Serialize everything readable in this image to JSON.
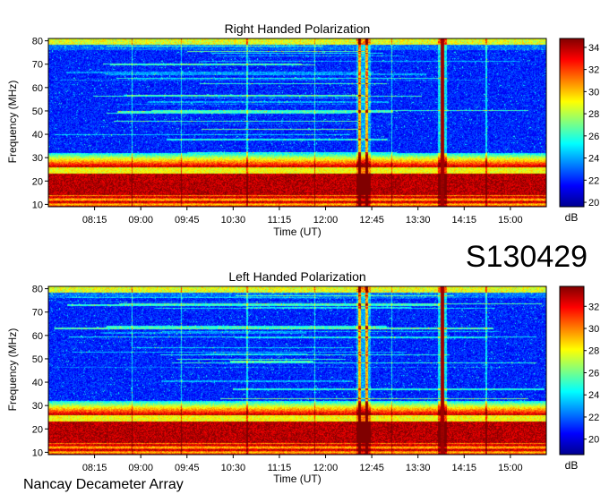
{
  "chart_data": [
    {
      "type": "heatmap",
      "title": "Right Handed Polarization",
      "xlabel": "Time (UT)",
      "ylabel": "Frequency (MHz)",
      "x_ticks": [
        "08:15",
        "09:00",
        "09:45",
        "10:30",
        "11:15",
        "12:00",
        "12:45",
        "13:30",
        "14:15",
        "15:00"
      ],
      "x_tick_minutes": [
        495,
        540,
        585,
        630,
        675,
        720,
        765,
        810,
        855,
        900
      ],
      "xlim_minutes": [
        450,
        935
      ],
      "y_ticks": [
        10,
        20,
        30,
        40,
        50,
        60,
        70,
        80
      ],
      "ylim": [
        9,
        81
      ],
      "colorbar": {
        "label": "dB",
        "ticks": [
          20,
          22,
          24,
          26,
          28,
          30,
          32,
          34
        ],
        "range": [
          19.6,
          34.8
        ],
        "colormap": [
          "#00008f",
          "#0000ff",
          "#0080ff",
          "#00ffff",
          "#80ff80",
          "#ffff00",
          "#ff8000",
          "#ff0000",
          "#800000"
        ]
      },
      "features": {
        "background_db": 22,
        "low_band_mhz": [
          10,
          30
        ],
        "low_band_db": 34,
        "intense_bursts_time": [
          "13:53"
        ],
        "bright_bursts_time": [
          "12:33",
          "12:40"
        ],
        "vertical_lines_time": [
          "08:51",
          "09:39",
          "10:43",
          "11:49",
          "13:04",
          "14:36"
        ]
      }
    },
    {
      "type": "heatmap",
      "title": "Left Handed Polarization",
      "xlabel": "Time (UT)",
      "ylabel": "Frequency (MHz)",
      "x_ticks": [
        "08:15",
        "09:00",
        "09:45",
        "10:30",
        "11:15",
        "12:00",
        "12:45",
        "13:30",
        "14:15",
        "15:00"
      ],
      "x_tick_minutes": [
        495,
        540,
        585,
        630,
        675,
        720,
        765,
        810,
        855,
        900
      ],
      "xlim_minutes": [
        450,
        935
      ],
      "y_ticks": [
        10,
        20,
        30,
        40,
        50,
        60,
        70,
        80
      ],
      "ylim": [
        9,
        81
      ],
      "colorbar": {
        "label": "dB",
        "ticks": [
          20,
          22,
          24,
          26,
          28,
          30,
          32
        ],
        "range": [
          18.6,
          33.8
        ],
        "colormap": [
          "#00008f",
          "#0000ff",
          "#0080ff",
          "#00ffff",
          "#80ff80",
          "#ffff00",
          "#ff8000",
          "#ff0000",
          "#800000"
        ]
      },
      "features": {
        "background_db": 21,
        "low_band_mhz": [
          10,
          30
        ],
        "low_band_db": 33,
        "intense_bursts_time": [
          "13:53"
        ],
        "bright_bursts_time": [
          "12:33",
          "12:40"
        ],
        "vertical_lines_time": [
          "08:51",
          "09:39",
          "10:43",
          "11:49",
          "13:04",
          "14:36"
        ]
      }
    }
  ],
  "header": {
    "event_id": "S130429"
  },
  "footer": {
    "observatory": "Nancay Decameter Array"
  }
}
